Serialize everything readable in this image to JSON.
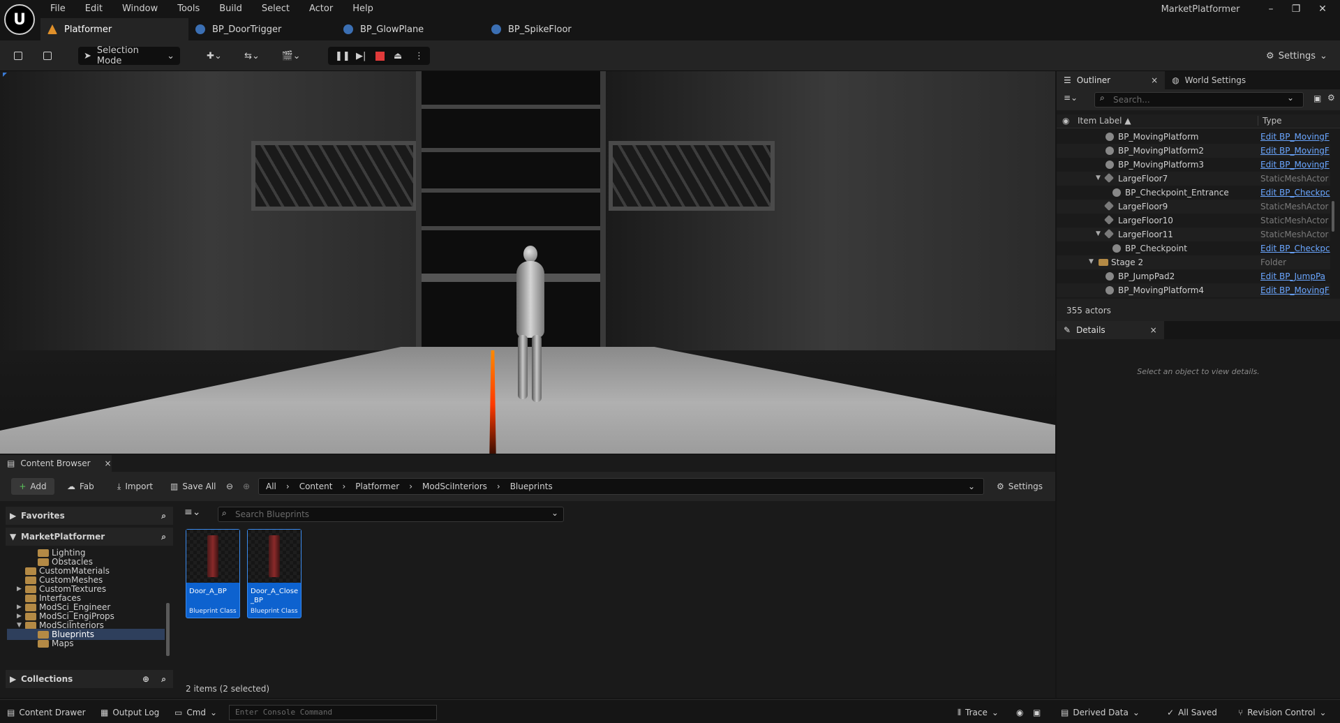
{
  "window": {
    "project_title": "MarketPlatformer",
    "minimize": "–",
    "restore": "❐",
    "close": "✕",
    "logo": "U"
  },
  "menu": [
    "File",
    "Edit",
    "Window",
    "Tools",
    "Build",
    "Select",
    "Actor",
    "Help"
  ],
  "tabs": [
    {
      "label": "Platformer"
    },
    {
      "label": "BP_DoorTrigger"
    },
    {
      "label": "BP_GlowPlane"
    },
    {
      "label": "BP_SpikeFloor"
    }
  ],
  "toolbar": {
    "selection_mode": "Selection Mode",
    "settings": "Settings"
  },
  "outliner": {
    "tab_label": "Outliner",
    "world_settings": "World Settings",
    "search_placeholder": "Search...",
    "col_label": "Item Label ▲",
    "col_type": "Type",
    "rows": [
      {
        "name": "BP_MovingPlatform",
        "type": "Edit BP_MovingF",
        "kind": "bp",
        "indent": 1,
        "expand": ""
      },
      {
        "name": "BP_MovingPlatform2",
        "type": "Edit BP_MovingF",
        "kind": "bp",
        "indent": 1,
        "expand": ""
      },
      {
        "name": "BP_MovingPlatform3",
        "type": "Edit BP_MovingF",
        "kind": "bp",
        "indent": 1,
        "expand": ""
      },
      {
        "name": "LargeFloor7",
        "type": "StaticMeshActor",
        "kind": "mesh",
        "indent": 1,
        "expand": "▼"
      },
      {
        "name": "BP_Checkpoint_Entrance",
        "type": "Edit BP_Checkpc",
        "kind": "bp",
        "indent": 2,
        "expand": ""
      },
      {
        "name": "LargeFloor9",
        "type": "StaticMeshActor",
        "kind": "mesh",
        "indent": 1,
        "expand": ""
      },
      {
        "name": "LargeFloor10",
        "type": "StaticMeshActor",
        "kind": "mesh",
        "indent": 1,
        "expand": ""
      },
      {
        "name": "LargeFloor11",
        "type": "StaticMeshActor",
        "kind": "mesh",
        "indent": 1,
        "expand": "▼"
      },
      {
        "name": "BP_Checkpoint",
        "type": "Edit BP_Checkpc",
        "kind": "bp",
        "indent": 2,
        "expand": ""
      },
      {
        "name": "Stage 2",
        "type": "Folder",
        "kind": "folder",
        "indent": 0,
        "expand": "▼"
      },
      {
        "name": "BP_JumpPad2",
        "type": "Edit BP_JumpPa",
        "kind": "bp",
        "indent": 1,
        "expand": ""
      },
      {
        "name": "BP_MovingPlatform4",
        "type": "Edit BP_MovingF",
        "kind": "bp",
        "indent": 1,
        "expand": ""
      }
    ],
    "actor_count": "355 actors"
  },
  "details": {
    "tab_label": "Details",
    "empty_message": "Select an object to view details."
  },
  "content_browser": {
    "tab_label": "Content Browser",
    "add": "Add",
    "fab": "Fab",
    "import": "Import",
    "save_all": "Save All",
    "settings": "Settings",
    "path": [
      "All",
      "Content",
      "Platformer",
      "ModSciInteriors",
      "Blueprints"
    ],
    "favorites": "Favorites",
    "project": "MarketPlatformer",
    "collections": "Collections",
    "tree": [
      {
        "label": "Lighting",
        "depth": 2,
        "expand": "",
        "selected": false
      },
      {
        "label": "Obstacles",
        "depth": 2,
        "expand": "",
        "selected": false
      },
      {
        "label": "CustomMaterials",
        "depth": 1,
        "expand": "",
        "selected": false
      },
      {
        "label": "CustomMeshes",
        "depth": 1,
        "expand": "",
        "selected": false
      },
      {
        "label": "CustomTextures",
        "depth": 1,
        "expand": "▶",
        "selected": false
      },
      {
        "label": "Interfaces",
        "depth": 1,
        "expand": "",
        "selected": false
      },
      {
        "label": "ModSci_Engineer",
        "depth": 1,
        "expand": "▶",
        "selected": false
      },
      {
        "label": "ModSci_EngiProps",
        "depth": 1,
        "expand": "▶",
        "selected": false
      },
      {
        "label": "ModSciInteriors",
        "depth": 1,
        "expand": "▼",
        "selected": false
      },
      {
        "label": "Blueprints",
        "depth": 2,
        "expand": "",
        "selected": true
      },
      {
        "label": "Maps",
        "depth": 2,
        "expand": "",
        "selected": false
      }
    ],
    "search_placeholder": "Search Blueprints",
    "assets": [
      {
        "name": "Door_A_BP",
        "class": "Blueprint Class"
      },
      {
        "name": "Door_A_Close_BP",
        "class": "Blueprint Class"
      }
    ],
    "items_count": "2 items (2 selected)"
  },
  "statusbar": {
    "content_drawer": "Content Drawer",
    "output_log": "Output Log",
    "cmd": "Cmd",
    "console_placeholder": "Enter Console Command",
    "trace": "Trace",
    "derived_data": "Derived Data",
    "all_saved": "All Saved",
    "revision_control": "Revision Control"
  }
}
